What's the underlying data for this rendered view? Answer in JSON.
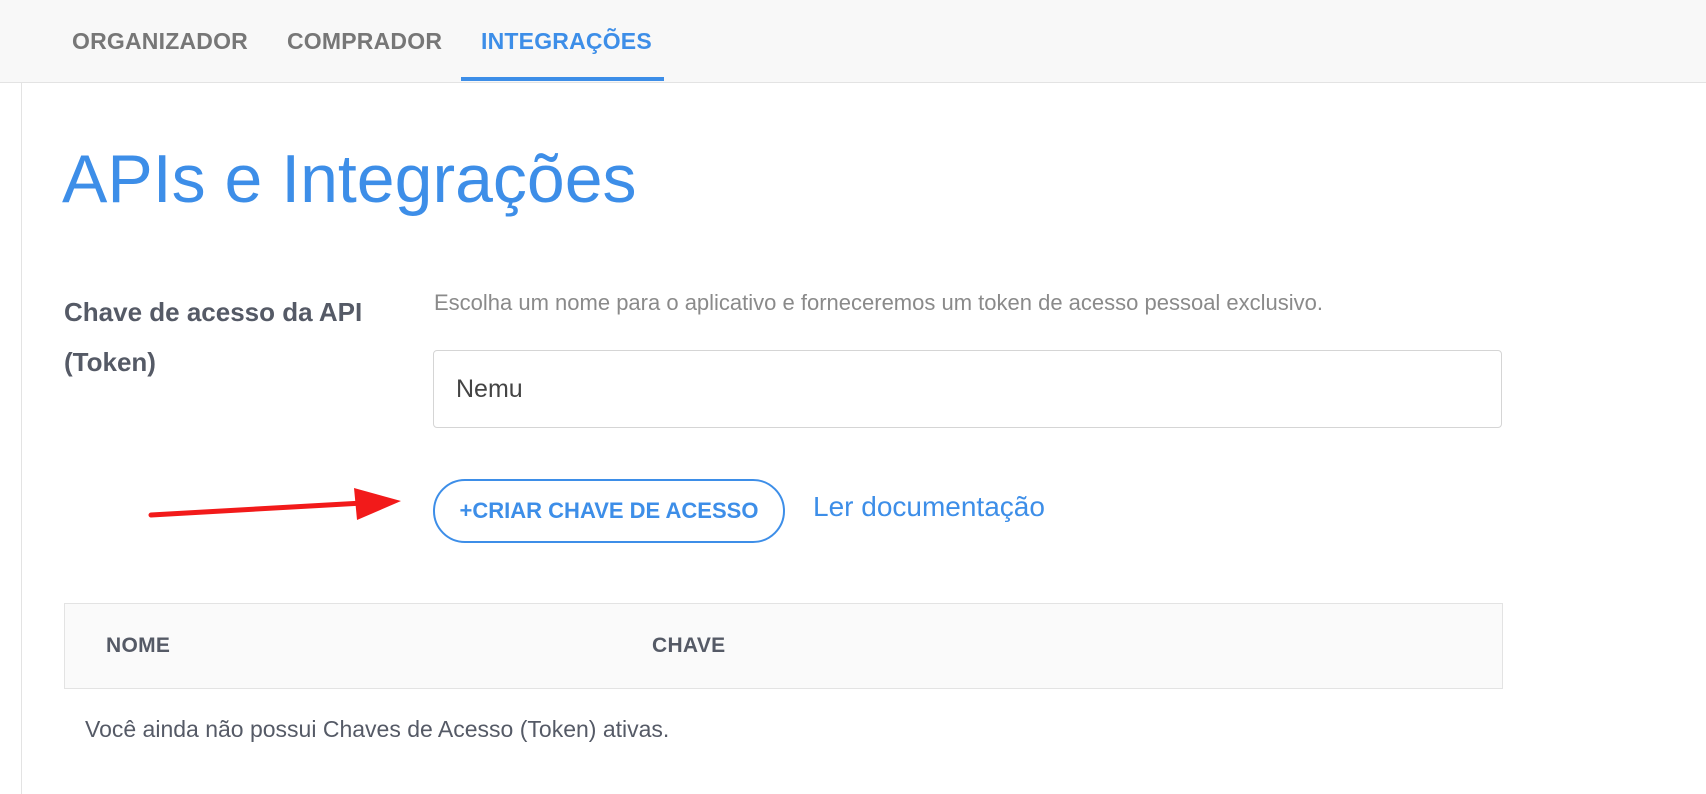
{
  "nav": {
    "tabs": [
      {
        "label": "ORGANIZADOR",
        "active": false
      },
      {
        "label": "COMPRADOR",
        "active": false
      },
      {
        "label": "INTEGRAÇÕES",
        "active": true
      }
    ]
  },
  "page": {
    "title": "APIs e Integrações"
  },
  "api_key_form": {
    "label": "Chave de acesso da API (Token)",
    "help_text": "Escolha um nome para o aplicativo e forneceremos um token de acesso pessoal exclusivo.",
    "name_value": "Nemu",
    "create_button_label": "+CRIAR CHAVE DE ACESSO",
    "docs_link_label": "Ler documentação"
  },
  "keys_table": {
    "columns": [
      "NOME",
      "CHAVE"
    ],
    "rows": [],
    "empty_message": "Você ainda não possui Chaves de Acesso (Token) ativas."
  },
  "annotation": {
    "arrow_color": "#f21a1a",
    "arrow_icon": "red-arrow-icon"
  },
  "colors": {
    "accent": "#3d8ee8",
    "text_dark": "#555a66",
    "text_muted": "#8a8a8a"
  }
}
